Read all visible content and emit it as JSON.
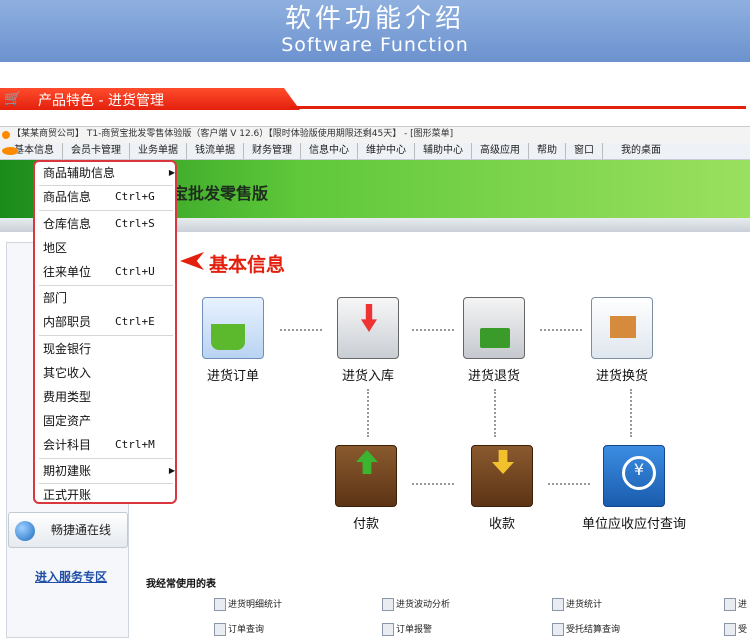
{
  "banner": {
    "title_zh": "软件功能介绍",
    "title_en": "Software Function"
  },
  "section": {
    "title": "产品特色 - 进货管理"
  },
  "window": {
    "title": "【某某商贸公司】 T1-商贸宝批发零售体验版（客户端 V 12.6）【限时体验版使用期限还剩45天】 - [图形菜单]"
  },
  "menubar": [
    "基本信息",
    "会员卡管理",
    "业务单据",
    "钱流单据",
    "财务管理",
    "信息中心",
    "维护中心",
    "辅助中心",
    "高级应用",
    "帮助",
    "窗口",
    "我的桌面"
  ],
  "green_banner": {
    "label": "宝批发零售版"
  },
  "dropdown": {
    "items": [
      {
        "label": "商品辅助信息",
        "shortcut": "",
        "submenu": true
      },
      {
        "label": "商品信息",
        "shortcut": "Ctrl+G"
      },
      {
        "label": "仓库信息",
        "shortcut": "Ctrl+S"
      },
      {
        "label": "地区",
        "shortcut": ""
      },
      {
        "label": "往来单位",
        "shortcut": "Ctrl+U"
      },
      {
        "label": "部门",
        "shortcut": ""
      },
      {
        "label": "内部职员",
        "shortcut": "Ctrl+E"
      },
      {
        "label": "现金银行",
        "shortcut": ""
      },
      {
        "label": "其它收入",
        "shortcut": ""
      },
      {
        "label": "费用类型",
        "shortcut": ""
      },
      {
        "label": "固定资产",
        "shortcut": ""
      },
      {
        "label": "会计科目",
        "shortcut": "Ctrl+M"
      },
      {
        "label": "期初建账",
        "shortcut": "",
        "submenu": true
      },
      {
        "label": "正式开账",
        "shortcut": ""
      }
    ]
  },
  "callout": {
    "text": "基本信息"
  },
  "flow": {
    "order": "进货订单",
    "stock_in": "进货入库",
    "return": "进货退货",
    "exchange": "进货换货",
    "payment": "付款",
    "receipt": "收款",
    "ar_ap_query": "单位应收应付查询"
  },
  "left": {
    "online": "畅捷通在线",
    "service": "进入服务专区"
  },
  "frequent": {
    "title": "我经常使用的表",
    "items": [
      "进货明细统计",
      "进货波动分析",
      "进货统计",
      "进",
      "订单查询",
      "订单报警",
      "受托结算查询",
      "受"
    ]
  }
}
